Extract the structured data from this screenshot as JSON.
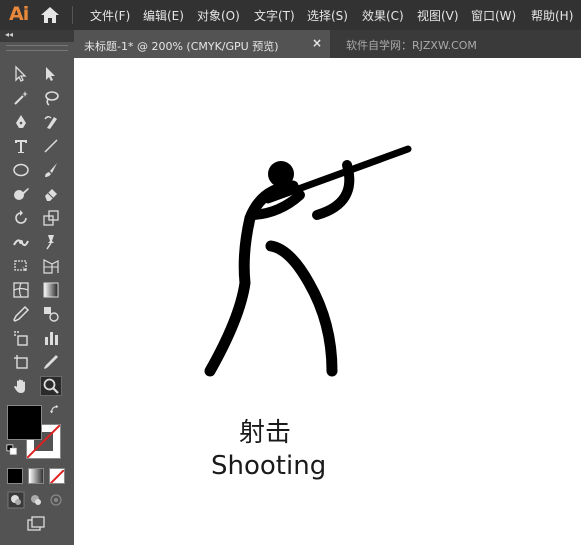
{
  "app": {
    "logo": "Ai"
  },
  "menu": [
    "文件(F)",
    "编辑(E)",
    "对象(O)",
    "文字(T)",
    "选择(S)",
    "效果(C)",
    "视图(V)",
    "窗口(W)",
    "帮助(H)"
  ],
  "document_tab": {
    "title": "未标题-1* @ 200% (CMYK/GPU 预览)",
    "close": "×"
  },
  "watermark": "软件自学网：RJZXW.COM",
  "toolbar": {
    "collapse": "◂◂"
  },
  "canvas": {
    "label_cn": "射击",
    "label_en": "Shooting"
  },
  "colors": {
    "menubar": "#323232",
    "panel": "#535353",
    "canvas": "#ffffff",
    "logo": "#e8883a"
  }
}
